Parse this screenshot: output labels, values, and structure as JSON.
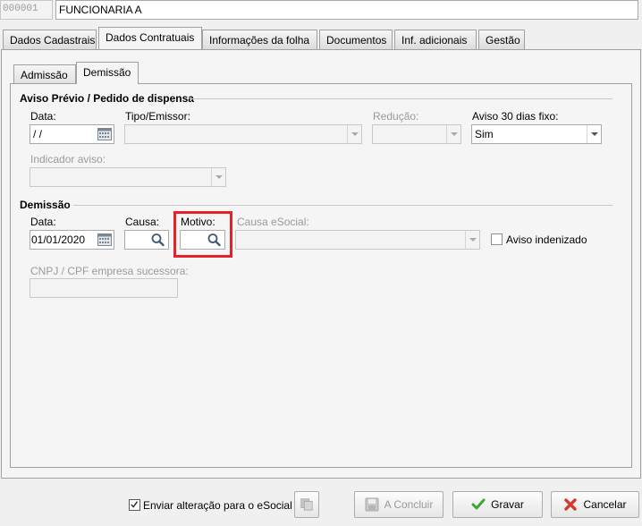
{
  "header": {
    "code": "000001",
    "name": "FUNCIONARIA A"
  },
  "main_tabs": [
    {
      "label": "Dados Cadastrais"
    },
    {
      "label": "Dados Contratuais"
    },
    {
      "label": "Informações da folha"
    },
    {
      "label": "Documentos"
    },
    {
      "label": "Inf. adicionais"
    },
    {
      "label": "Gestão"
    }
  ],
  "sub_tabs": [
    {
      "label": "Admissão"
    },
    {
      "label": "Demissão"
    }
  ],
  "aviso": {
    "section_title": "Aviso Prévio / Pedido de dispensa",
    "data_label": "Data:",
    "data_value": " /  /",
    "tipo_label": "Tipo/Emissor:",
    "reducao_label": "Redução:",
    "aviso30_label": "Aviso 30 dias fixo:",
    "aviso30_value": "Sim",
    "indicador_label": "Indicador aviso:"
  },
  "demissao": {
    "section_title": "Demissão",
    "data_label": "Data:",
    "data_value": "01/01/2020",
    "causa_label": "Causa:",
    "motivo_label": "Motivo:",
    "causa_esocial_label": "Causa eSocial:",
    "aviso_indenizado_label": "Aviso indenizado",
    "cnpj_label": "CNPJ / CPF empresa sucessora:"
  },
  "footer": {
    "enviar_label": "Enviar alteração para o eSocial",
    "enviar_checked": true,
    "concluir_label": "A Concluir",
    "gravar_label": "Gravar",
    "cancelar_label": "Cancelar"
  },
  "colors": {
    "highlight": "#e8202a",
    "check_green": "#3aa636",
    "cancel_red": "#d43a2a"
  }
}
